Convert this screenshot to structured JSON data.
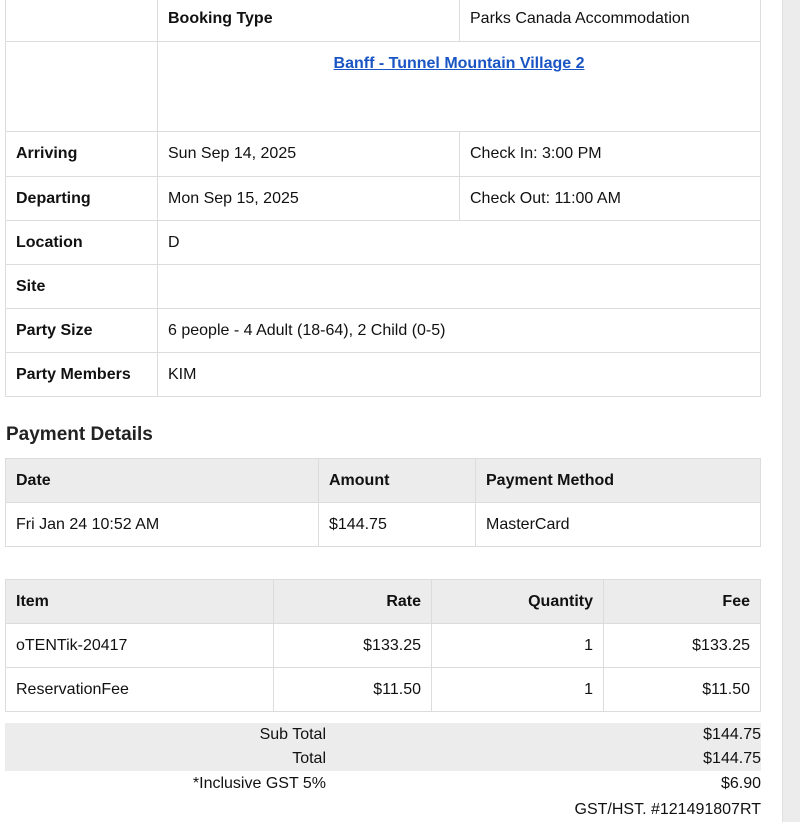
{
  "booking": {
    "type_label": "Booking Type",
    "type_value": "Parks Canada Accommodation",
    "site_link": "Banff - Tunnel Mountain Village 2",
    "arriving_label": "Arriving",
    "arriving_date": "Sun Sep 14, 2025",
    "check_in": "Check In: 3:00 PM",
    "departing_label": "Departing",
    "departing_date": "Mon Sep 15, 2025",
    "check_out": "Check Out: 11:00 AM",
    "location_label": "Location",
    "location_value": "D",
    "site_label": "Site",
    "site_value": "",
    "party_size_label": "Party Size",
    "party_size_value": "6 people - 4 Adult (18-64), 2 Child (0-5)",
    "party_members_label": "Party Members",
    "party_members_value": "KIM"
  },
  "payment": {
    "heading": "Payment Details",
    "headers": [
      "Date",
      "Amount",
      "Payment Method"
    ],
    "row": [
      "Fri Jan 24 10:52 AM",
      "$144.75",
      "MasterCard"
    ]
  },
  "items": {
    "headers": [
      "Item",
      "Rate",
      "Quantity",
      "Fee"
    ],
    "rows": [
      [
        "oTENTik-20417",
        "$133.25",
        "1",
        "$133.25"
      ],
      [
        "ReservationFee",
        "$11.50",
        "1",
        "$11.50"
      ]
    ]
  },
  "totals": {
    "subtotal_label": "Sub Total",
    "subtotal_value": "$144.75",
    "total_label": "Total",
    "total_value": "$144.75",
    "gst_label": "*Inclusive GST 5%",
    "gst_value": "$6.90",
    "gst_number": "GST/HST. #121491807RT"
  }
}
